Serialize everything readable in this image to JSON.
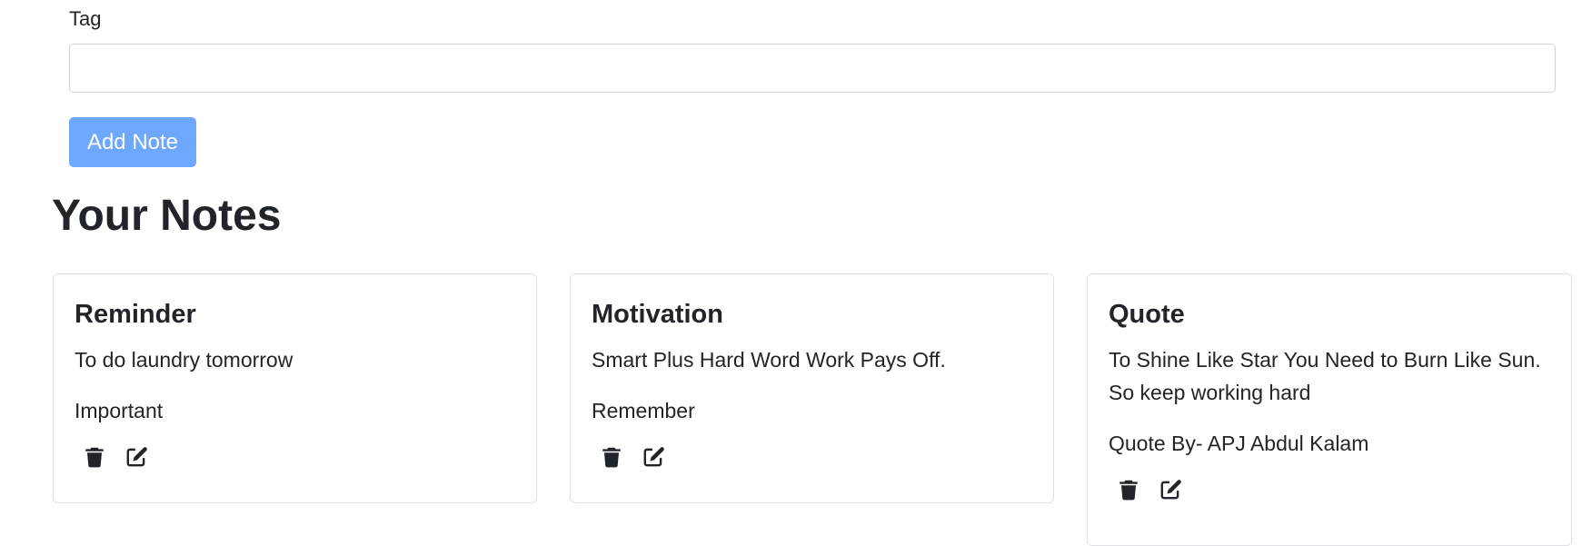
{
  "form": {
    "tag_label": "Tag",
    "tag_value": "",
    "add_button_label": "Add Note"
  },
  "notes_section": {
    "title": "Your Notes"
  },
  "notes": [
    {
      "title": "Reminder",
      "description": "To do laundry tomorrow",
      "tag": "Important",
      "delete_icon": "trash-icon",
      "edit_icon": "edit-icon"
    },
    {
      "title": "Motivation",
      "description": "Smart Plus Hard Word Work Pays Off.",
      "tag": "Remember",
      "delete_icon": "trash-icon",
      "edit_icon": "edit-icon"
    },
    {
      "title": "Quote",
      "description": "To Shine Like Star You Need to Burn Like Sun. So keep working hard",
      "tag": "Quote By- APJ Abdul Kalam",
      "delete_icon": "trash-icon",
      "edit_icon": "edit-icon"
    }
  ],
  "colors": {
    "primary_button": "#6ea8fe",
    "text": "#212529",
    "border": "#dee2e6"
  }
}
